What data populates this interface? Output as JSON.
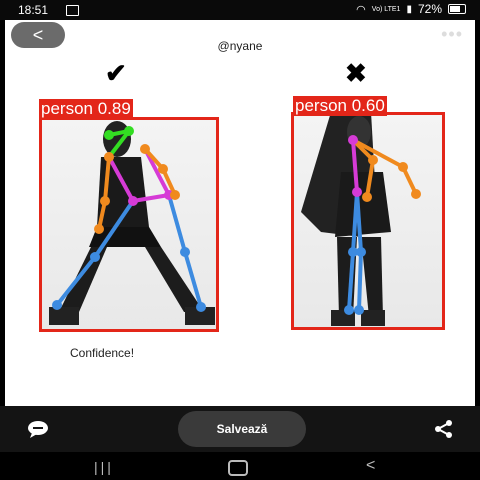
{
  "status_bar": {
    "time": "18:51",
    "network": "Vo) LTE1",
    "battery": "72%"
  },
  "header": {
    "back_icon": "<",
    "more_icon": "•••",
    "username": "@nyane"
  },
  "marks": {
    "good": "✔",
    "bad": "✖"
  },
  "detections": [
    {
      "label": "person 0.89"
    },
    {
      "label": "person 0.60"
    }
  ],
  "caption": "Confidence!",
  "bottom_bar": {
    "save_label": "Salvează"
  },
  "nav_bar": {
    "recents": "|||",
    "back": "<"
  },
  "colors": {
    "box": "#e32619",
    "skeleton_blue": "#3d8be0",
    "skeleton_orange": "#f08a1e",
    "skeleton_magenta": "#d63bd6",
    "skeleton_green": "#33dd22"
  }
}
